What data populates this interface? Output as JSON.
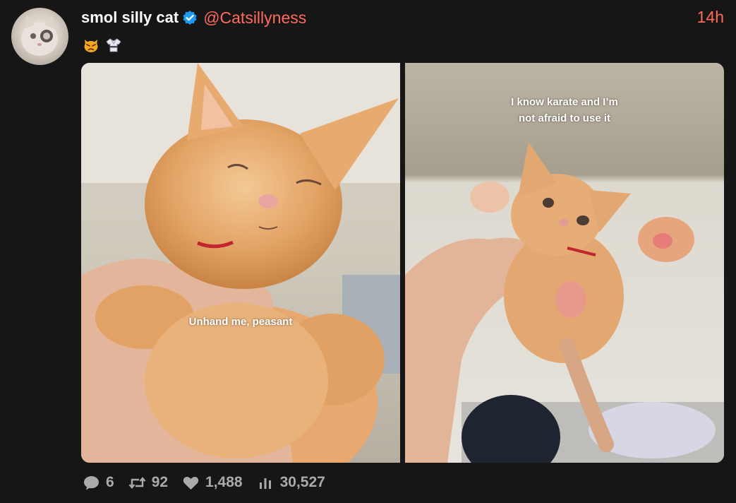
{
  "post": {
    "display_name": "smol silly cat",
    "handle": "@Catsillyness",
    "timestamp": "14h",
    "verified": true,
    "bio_emojis": [
      "cat-angry-emoji",
      "karate-gi-emoji"
    ]
  },
  "media": {
    "left": {
      "caption": "Unhand me, peasant"
    },
    "right": {
      "caption_line1": "I know karate and I’m",
      "caption_line2": "not afraid to use it"
    }
  },
  "stats": {
    "replies": "6",
    "reposts": "92",
    "likes": "1,488",
    "views": "30,527"
  },
  "colors": {
    "background": "#161616",
    "accent": "#ff6b5a",
    "verified": "#1d9bf0",
    "muted": "#aaaaaa"
  }
}
